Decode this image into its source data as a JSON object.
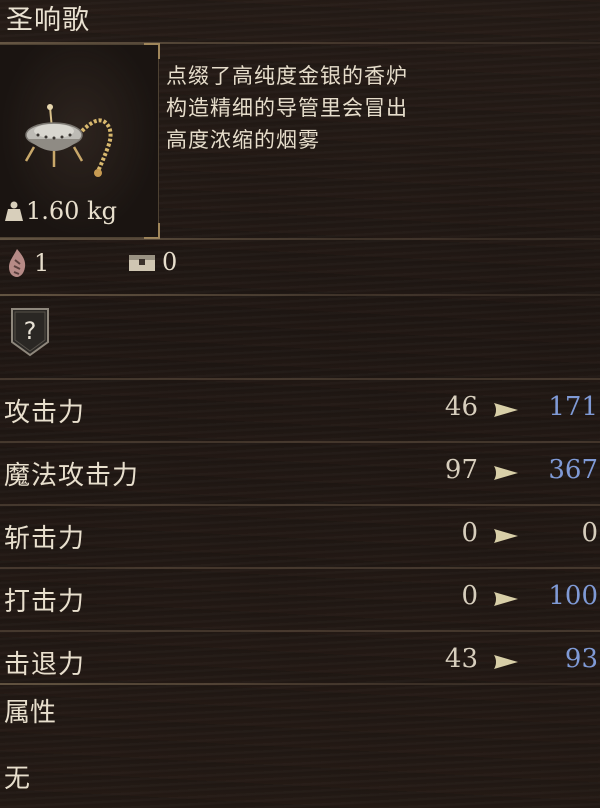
{
  "item": {
    "title": "圣响歌",
    "weight": "1.60 kg",
    "description": [
      "点缀了高纯度金银的香炉",
      "构造精细的导管里会冒出",
      "高度浓缩的烟雾"
    ],
    "icon": "censer-icon"
  },
  "requirements": {
    "faith": {
      "icon": "faith-flame-icon",
      "value": "1"
    },
    "slot": {
      "icon": "chest-icon",
      "value": "0"
    }
  },
  "unknown_badge": {
    "icon": "question-mark-icon"
  },
  "stats": [
    {
      "label": "攻击力",
      "base": "46",
      "new": "171",
      "new_color": "#7f9ad6"
    },
    {
      "label": "魔法攻击力",
      "base": "97",
      "new": "367",
      "new_color": "#7f9ad6"
    },
    {
      "label": "斩击力",
      "base": "0",
      "new": "0",
      "new_color": "#d7cebd"
    },
    {
      "label": "打击力",
      "base": "0",
      "new": "100",
      "new_color": "#7f9ad6"
    },
    {
      "label": "击退力",
      "base": "43",
      "new": "93",
      "new_color": "#7f9ad6"
    }
  ],
  "attribute": {
    "label": "属性",
    "value": "无"
  },
  "colors": {
    "increase": "#7f9ad6",
    "neutral": "#d7cebd",
    "arrow": "#d8cfa8"
  }
}
